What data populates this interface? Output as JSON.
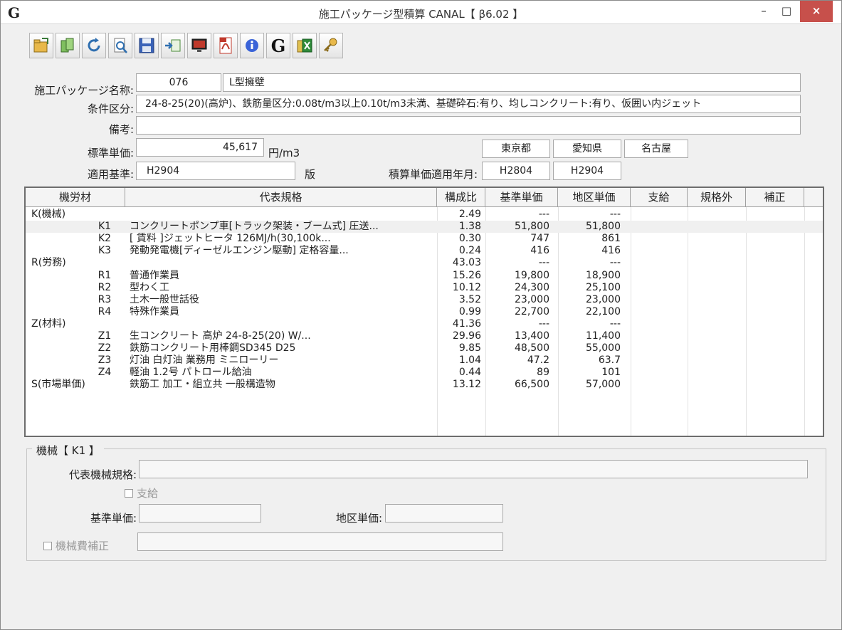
{
  "window": {
    "app_icon": "G",
    "title": "施工パッケージ型積算 CANAL【 β6.02 】",
    "minimize": "–",
    "maximize": "□",
    "close": "×"
  },
  "toolbar": {
    "icons": [
      "open-folder-icon",
      "copy-icon",
      "refresh-icon",
      "preview-icon",
      "save-icon",
      "import-icon",
      "monitor-icon",
      "pdf-icon",
      "info-icon",
      "g-logo-icon",
      "excel-icon",
      "key-icon"
    ],
    "g_label": "G"
  },
  "form": {
    "package_name_label": "施工パッケージ名称:",
    "package_code": "076",
    "package_name": "L型擁壁",
    "condition_label": "条件区分:",
    "condition_value": "24-8-25(20)(高炉)、鉄筋量区分:0.08t/m3以上0.10t/m3未満、基礎砕石:有り、均しコンクリート:有り、仮囲い内ジェット",
    "remarks_label": "備考:",
    "remarks_value": "",
    "std_price_label": "標準単価:",
    "std_price_value": "45,617",
    "std_price_unit": "円/m3",
    "region_1": "東京都",
    "region_2": "愛知県",
    "region_3": "名古屋",
    "basis_label": "適用基準:",
    "basis_value": "H2904",
    "edition_label": "版",
    "ym_label": "積算単価適用年月:",
    "ym_1": "H2804",
    "ym_2": "H2904"
  },
  "table": {
    "headers": [
      "機労材",
      "代表規格",
      "構成比",
      "基準単価",
      "地区単価",
      "支給",
      "規格外",
      "補正"
    ],
    "rows": [
      {
        "cat": "K(機械)",
        "code": "",
        "spec": "",
        "ratio": "2.49",
        "base": "---",
        "region": "---"
      },
      {
        "cat": "",
        "code": "K1",
        "spec": "コンクリートポンプ車[トラック架装・ブーム式] 圧送...",
        "ratio": "1.38",
        "base": "51,800",
        "region": "51,800"
      },
      {
        "cat": "",
        "code": "K2",
        "spec": "[ 賃料 ]ジェットヒータ 126MJ/h(30,100k...",
        "ratio": "0.30",
        "base": "747",
        "region": "861"
      },
      {
        "cat": "",
        "code": "K3",
        "spec": "発動発電機[ディーゼルエンジン駆動] 定格容量...",
        "ratio": "0.24",
        "base": "416",
        "region": "416"
      },
      {
        "cat": "R(労務)",
        "code": "",
        "spec": "",
        "ratio": "43.03",
        "base": "---",
        "region": "---"
      },
      {
        "cat": "",
        "code": "R1",
        "spec": "普通作業員",
        "ratio": "15.26",
        "base": "19,800",
        "region": "18,900"
      },
      {
        "cat": "",
        "code": "R2",
        "spec": "型わく工",
        "ratio": "10.12",
        "base": "24,300",
        "region": "25,100"
      },
      {
        "cat": "",
        "code": "R3",
        "spec": "土木一般世話役",
        "ratio": "3.52",
        "base": "23,000",
        "region": "23,000"
      },
      {
        "cat": "",
        "code": "R4",
        "spec": "特殊作業員",
        "ratio": "0.99",
        "base": "22,700",
        "region": "22,100"
      },
      {
        "cat": "Z(材料)",
        "code": "",
        "spec": "",
        "ratio": "41.36",
        "base": "---",
        "region": "---"
      },
      {
        "cat": "",
        "code": "Z1",
        "spec": "生コンクリート 高炉 24-8-25(20) W/...",
        "ratio": "29.96",
        "base": "13,400",
        "region": "11,400"
      },
      {
        "cat": "",
        "code": "Z2",
        "spec": "鉄筋コンクリート用棒鋼SD345 D25",
        "ratio": "9.85",
        "base": "48,500",
        "region": "55,000"
      },
      {
        "cat": "",
        "code": "Z3",
        "spec": "灯油 白灯油 業務用 ミニローリー",
        "ratio": "1.04",
        "base": "47.2",
        "region": "63.7"
      },
      {
        "cat": "",
        "code": "Z4",
        "spec": "軽油 1.2号 パトロール給油",
        "ratio": "0.44",
        "base": "89",
        "region": "101"
      },
      {
        "cat": "S(市場単価)",
        "code": "",
        "spec": "鉄筋工 加工・組立共 一般構造物",
        "ratio": "13.12",
        "base": "66,500",
        "region": "57,000"
      }
    ]
  },
  "detail": {
    "group_title": "機械【 K1 】",
    "spec_label": "代表機械規格:",
    "spec_value": "",
    "supply_label": "支給",
    "base_label": "基準単価:",
    "base_value": "",
    "region_label": "地区単価:",
    "region_value": "",
    "correction_label": "機械費補正",
    "correction_value": ""
  }
}
